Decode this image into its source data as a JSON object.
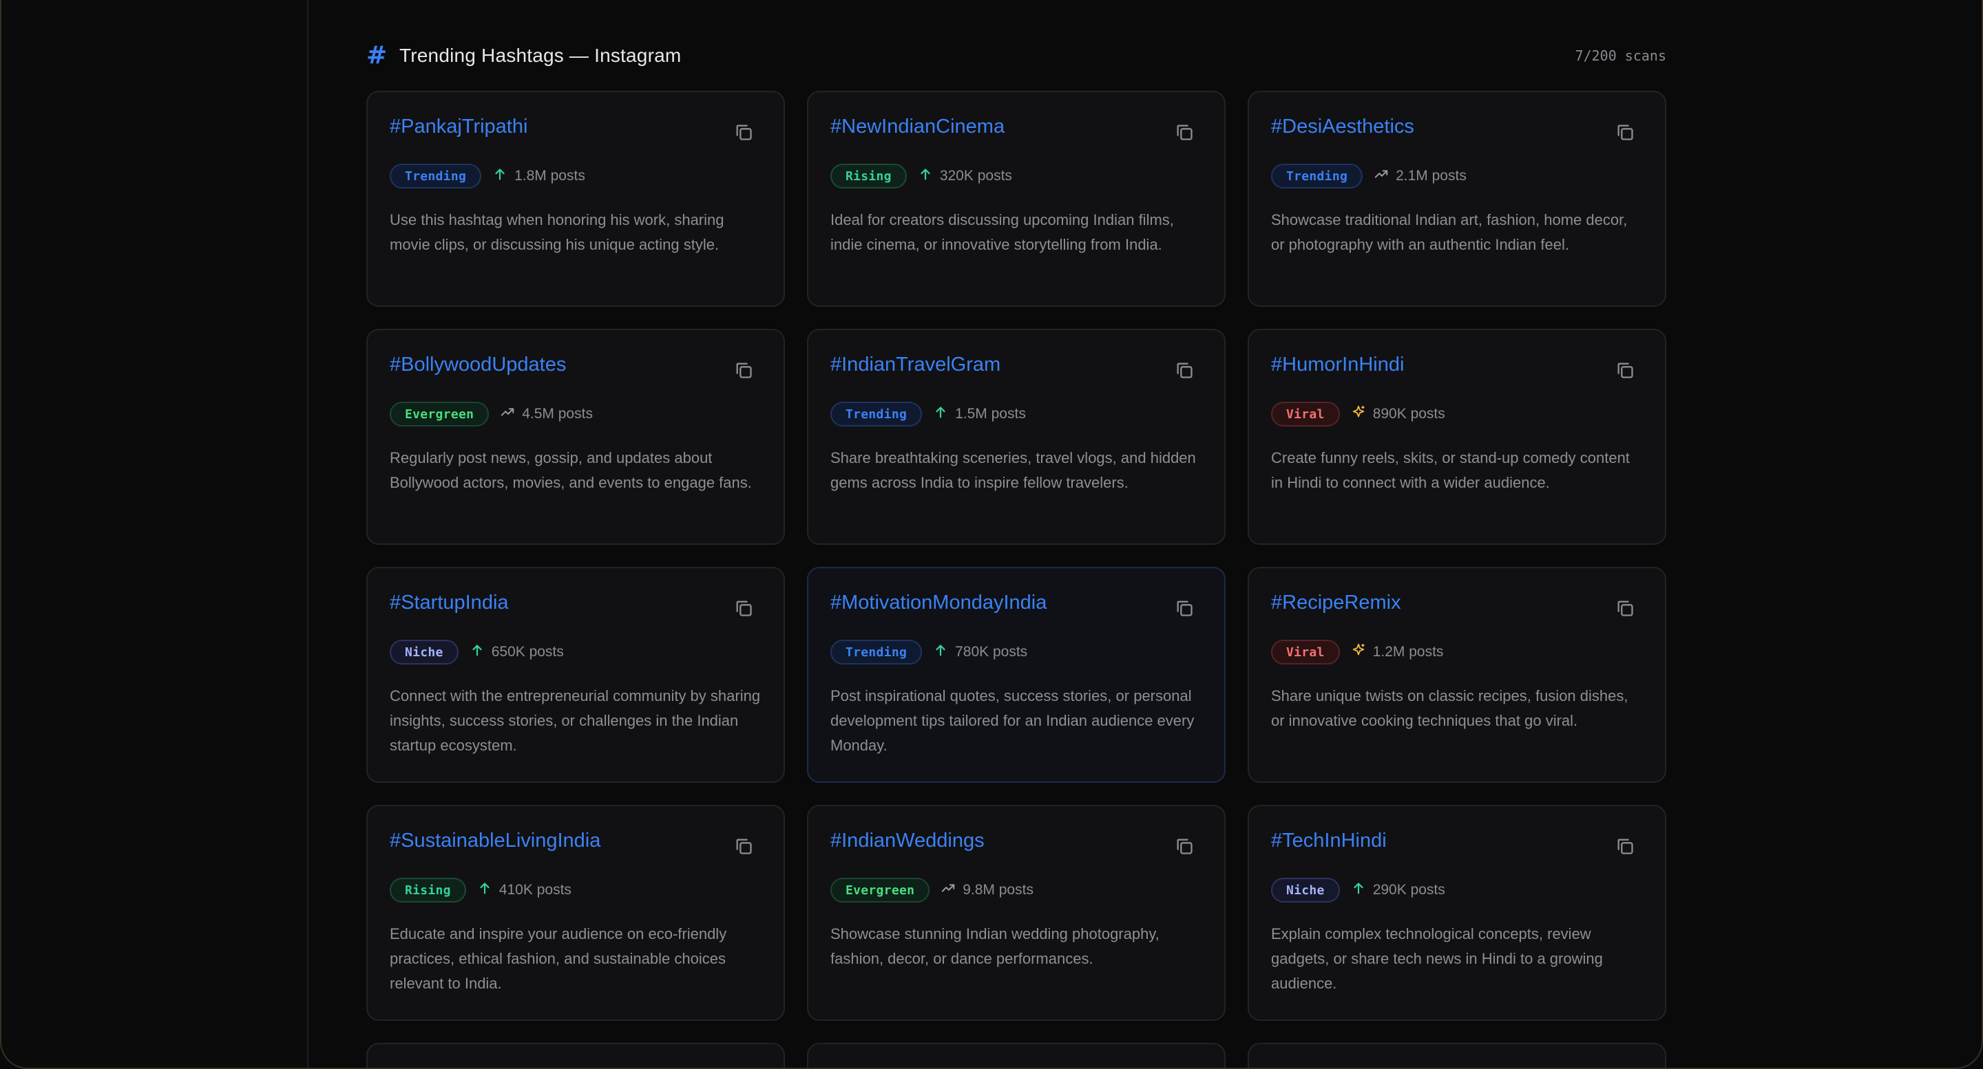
{
  "header": {
    "title": "Trending Hashtags — Instagram",
    "scans": "7/200 scans"
  },
  "colors": {
    "accent": "#3b82f6",
    "background": "#0a0a0b",
    "card": "#111113"
  },
  "cards": [
    {
      "tag": "#PankajTripathi",
      "badge": "Trending",
      "badge_type": "trending",
      "trend_icon": "arrow-up-icon",
      "posts": "1.8M posts",
      "desc": "Use this hashtag when honoring his work, sharing movie clips, or discussing his unique acting style."
    },
    {
      "tag": "#NewIndianCinema",
      "badge": "Rising",
      "badge_type": "rising",
      "trend_icon": "arrow-up-icon",
      "posts": "320K posts",
      "desc": "Ideal for creators discussing upcoming Indian films, indie cinema, or innovative storytelling from India."
    },
    {
      "tag": "#DesiAesthetics",
      "badge": "Trending",
      "badge_type": "trending",
      "trend_icon": "trending-up-icon",
      "posts": "2.1M posts",
      "desc": "Showcase traditional Indian art, fashion, home decor, or photography with an authentic Indian feel."
    },
    {
      "tag": "#BollywoodUpdates",
      "badge": "Evergreen",
      "badge_type": "evergreen",
      "trend_icon": "trending-up-icon",
      "posts": "4.5M posts",
      "desc": "Regularly post news, gossip, and updates about Bollywood actors, movies, and events to engage fans."
    },
    {
      "tag": "#IndianTravelGram",
      "badge": "Trending",
      "badge_type": "trending",
      "trend_icon": "arrow-up-icon",
      "posts": "1.5M posts",
      "desc": "Share breathtaking sceneries, travel vlogs, and hidden gems across India to inspire fellow travelers."
    },
    {
      "tag": "#HumorInHindi",
      "badge": "Viral",
      "badge_type": "viral",
      "trend_icon": "sparkle-icon",
      "posts": "890K posts",
      "desc": "Create funny reels, skits, or stand-up comedy content in Hindi to connect with a wider audience."
    },
    {
      "tag": "#StartupIndia",
      "badge": "Niche",
      "badge_type": "niche",
      "trend_icon": "arrow-up-icon",
      "posts": "650K posts",
      "desc": "Connect with the entrepreneurial community by sharing insights, success stories, or challenges in the Indian startup ecosystem."
    },
    {
      "tag": "#MotivationMondayIndia",
      "badge": "Trending",
      "badge_type": "trending",
      "trend_icon": "arrow-up-icon",
      "posts": "780K posts",
      "desc": "Post inspirational quotes, success stories, or personal development tips tailored for an Indian audience every Monday."
    },
    {
      "tag": "#RecipeRemix",
      "badge": "Viral",
      "badge_type": "viral",
      "trend_icon": "sparkle-icon",
      "posts": "1.2M posts",
      "desc": "Share unique twists on classic recipes, fusion dishes, or innovative cooking techniques that go viral."
    },
    {
      "tag": "#SustainableLivingIndia",
      "badge": "Rising",
      "badge_type": "rising",
      "trend_icon": "arrow-up-icon",
      "posts": "410K posts",
      "desc": "Educate and inspire your audience on eco-friendly practices, ethical fashion, and sustainable choices relevant to India."
    },
    {
      "tag": "#IndianWeddings",
      "badge": "Evergreen",
      "badge_type": "evergreen",
      "trend_icon": "trending-up-icon",
      "posts": "9.8M posts",
      "desc": "Showcase stunning Indian wedding photography, fashion, decor, or dance performances."
    },
    {
      "tag": "#TechInHindi",
      "badge": "Niche",
      "badge_type": "niche",
      "trend_icon": "arrow-up-icon",
      "posts": "290K posts",
      "desc": "Explain complex technological concepts, review gadgets, or share tech news in Hindi to a growing audience."
    }
  ]
}
